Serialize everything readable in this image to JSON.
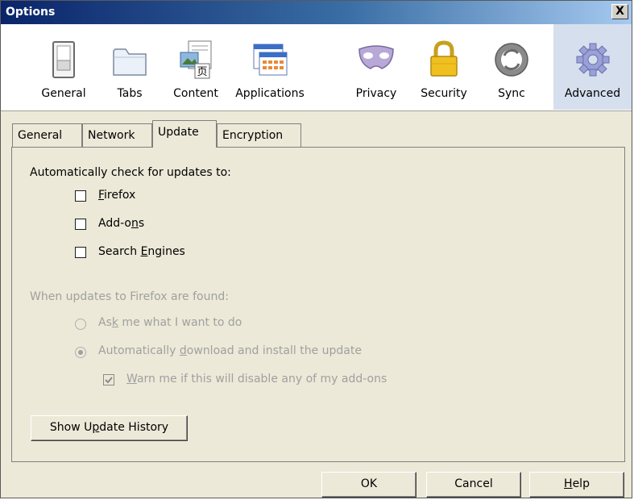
{
  "window": {
    "title": "Options",
    "close_label": "X"
  },
  "toolbar": {
    "panes": [
      {
        "label": "General",
        "icon": "light-switch-icon",
        "selected": false
      },
      {
        "label": "Tabs",
        "icon": "tabs-icon",
        "selected": false
      },
      {
        "label": "Content",
        "icon": "content-icon",
        "selected": false
      },
      {
        "label": "Applications",
        "icon": "applications-icon",
        "selected": false
      },
      {
        "label": "Privacy",
        "icon": "privacy-mask-icon",
        "selected": false
      },
      {
        "label": "Security",
        "icon": "padlock-icon",
        "selected": false
      },
      {
        "label": "Sync",
        "icon": "sync-icon",
        "selected": false
      },
      {
        "label": "Advanced",
        "icon": "gear-icon",
        "selected": true
      }
    ]
  },
  "tabs": [
    {
      "label": "General",
      "active": false
    },
    {
      "label": "Network",
      "active": false
    },
    {
      "label": "Update",
      "active": true
    },
    {
      "label": "Encryption",
      "active": false
    }
  ],
  "update": {
    "check_heading": "Automatically check for updates to:",
    "checkboxes": [
      {
        "pre": "",
        "accel": "F",
        "post": "irefox",
        "checked": false
      },
      {
        "pre": "Add-o",
        "accel": "n",
        "post": "s",
        "checked": false
      },
      {
        "pre": "Search ",
        "accel": "E",
        "post": "ngines",
        "checked": false
      }
    ],
    "found_heading": "When updates to Firefox are found:",
    "radio_ask": {
      "pre": "As",
      "accel": "k",
      "post": " me what I want to do",
      "selected": false
    },
    "radio_auto": {
      "pre": "Automatically ",
      "accel": "d",
      "post": "ownload and install the update",
      "selected": true
    },
    "warn": {
      "pre": "",
      "accel": "W",
      "post": "arn me if this will disable any of my add-ons",
      "checked": true
    },
    "history_button": {
      "pre": "Show U",
      "accel": "p",
      "post": "date History"
    }
  },
  "footer": {
    "ok": "OK",
    "cancel": "Cancel",
    "help_accel": "H",
    "help_rest": "elp"
  }
}
